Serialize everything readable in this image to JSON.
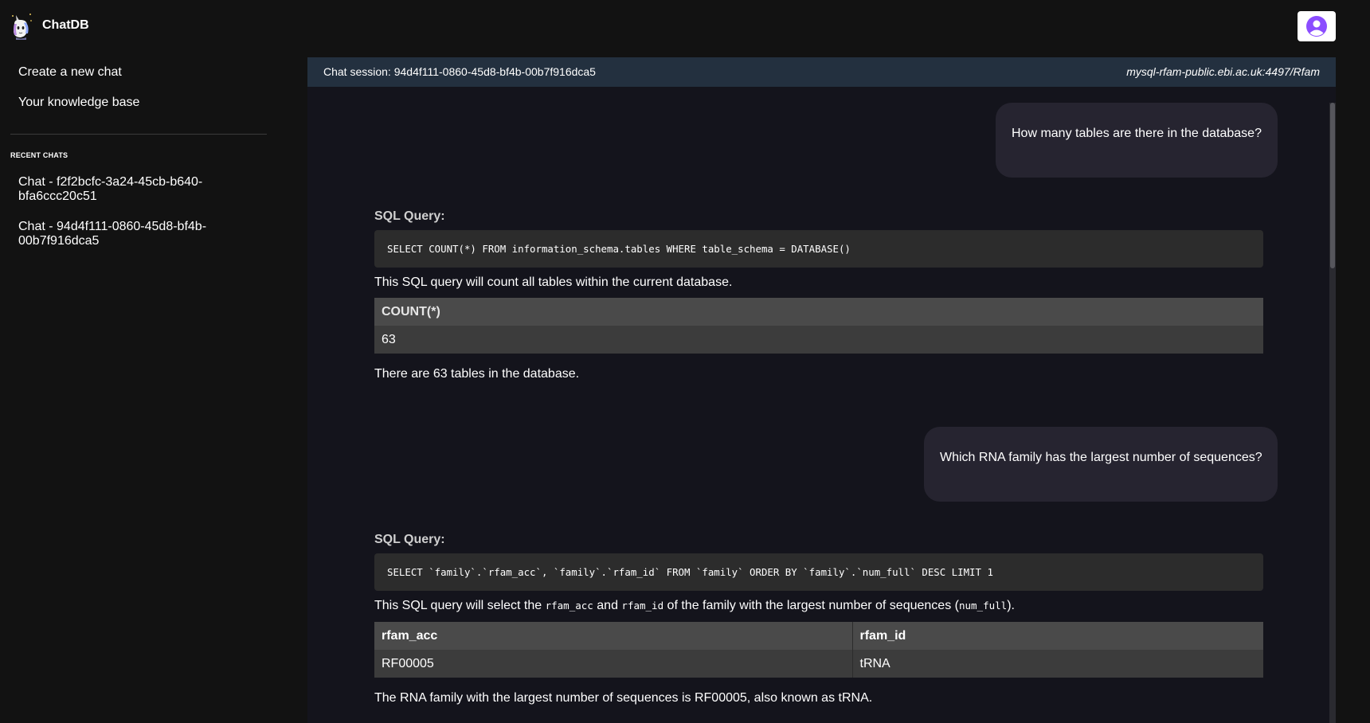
{
  "app": {
    "title": "ChatDB"
  },
  "sidebar": {
    "nav": [
      {
        "label": "Create a new chat"
      },
      {
        "label": "Your knowledge base"
      }
    ],
    "recent_title": "RECENT CHATS",
    "recent_chats": [
      {
        "label": "Chat - f2f2bcfc-3a24-45cb-b640-bfa6ccc20c51"
      },
      {
        "label": "Chat - 94d4f111-0860-45d8-bf4b-00b7f916dca5"
      }
    ]
  },
  "session": {
    "label": "Chat session: 94d4f111-0860-45d8-bf4b-00b7f916dca5",
    "connection": "mysql-rfam-public.ebi.ac.uk:4497/Rfam"
  },
  "messages": [
    {
      "question": "How many tables are there in the database?",
      "sql_label": "SQL Query:",
      "sql": "SELECT COUNT(*) FROM information_schema.tables WHERE table_schema = DATABASE()",
      "explanation": "This SQL query will count all tables within the current database.",
      "table": {
        "headers": [
          "COUNT(*)"
        ],
        "rows": [
          [
            "63"
          ]
        ]
      },
      "answer": "There are 63 tables in the database."
    },
    {
      "question": "Which RNA family has the largest number of sequences?",
      "sql_label": "SQL Query:",
      "sql": "SELECT `family`.`rfam_acc`, `family`.`rfam_id` FROM `family` ORDER BY `family`.`num_full` DESC LIMIT 1",
      "explanation_parts": [
        "This SQL query will select the ",
        "rfam_acc",
        " and ",
        "rfam_id",
        " of the family with the largest number of sequences (",
        "num_full",
        ")."
      ],
      "table": {
        "headers": [
          "rfam_acc",
          "rfam_id"
        ],
        "rows": [
          [
            "RF00005",
            "tRNA"
          ]
        ]
      },
      "answer": "The RNA family with the largest number of sequences is RF00005, also known as tRNA."
    }
  ],
  "icons": {
    "logo": "unicorn-logo-icon",
    "avatar": "user-avatar-icon"
  },
  "colors": {
    "avatar_accent": "#8b4dff",
    "session_bar": "#23303f",
    "bubble": "#262430"
  }
}
